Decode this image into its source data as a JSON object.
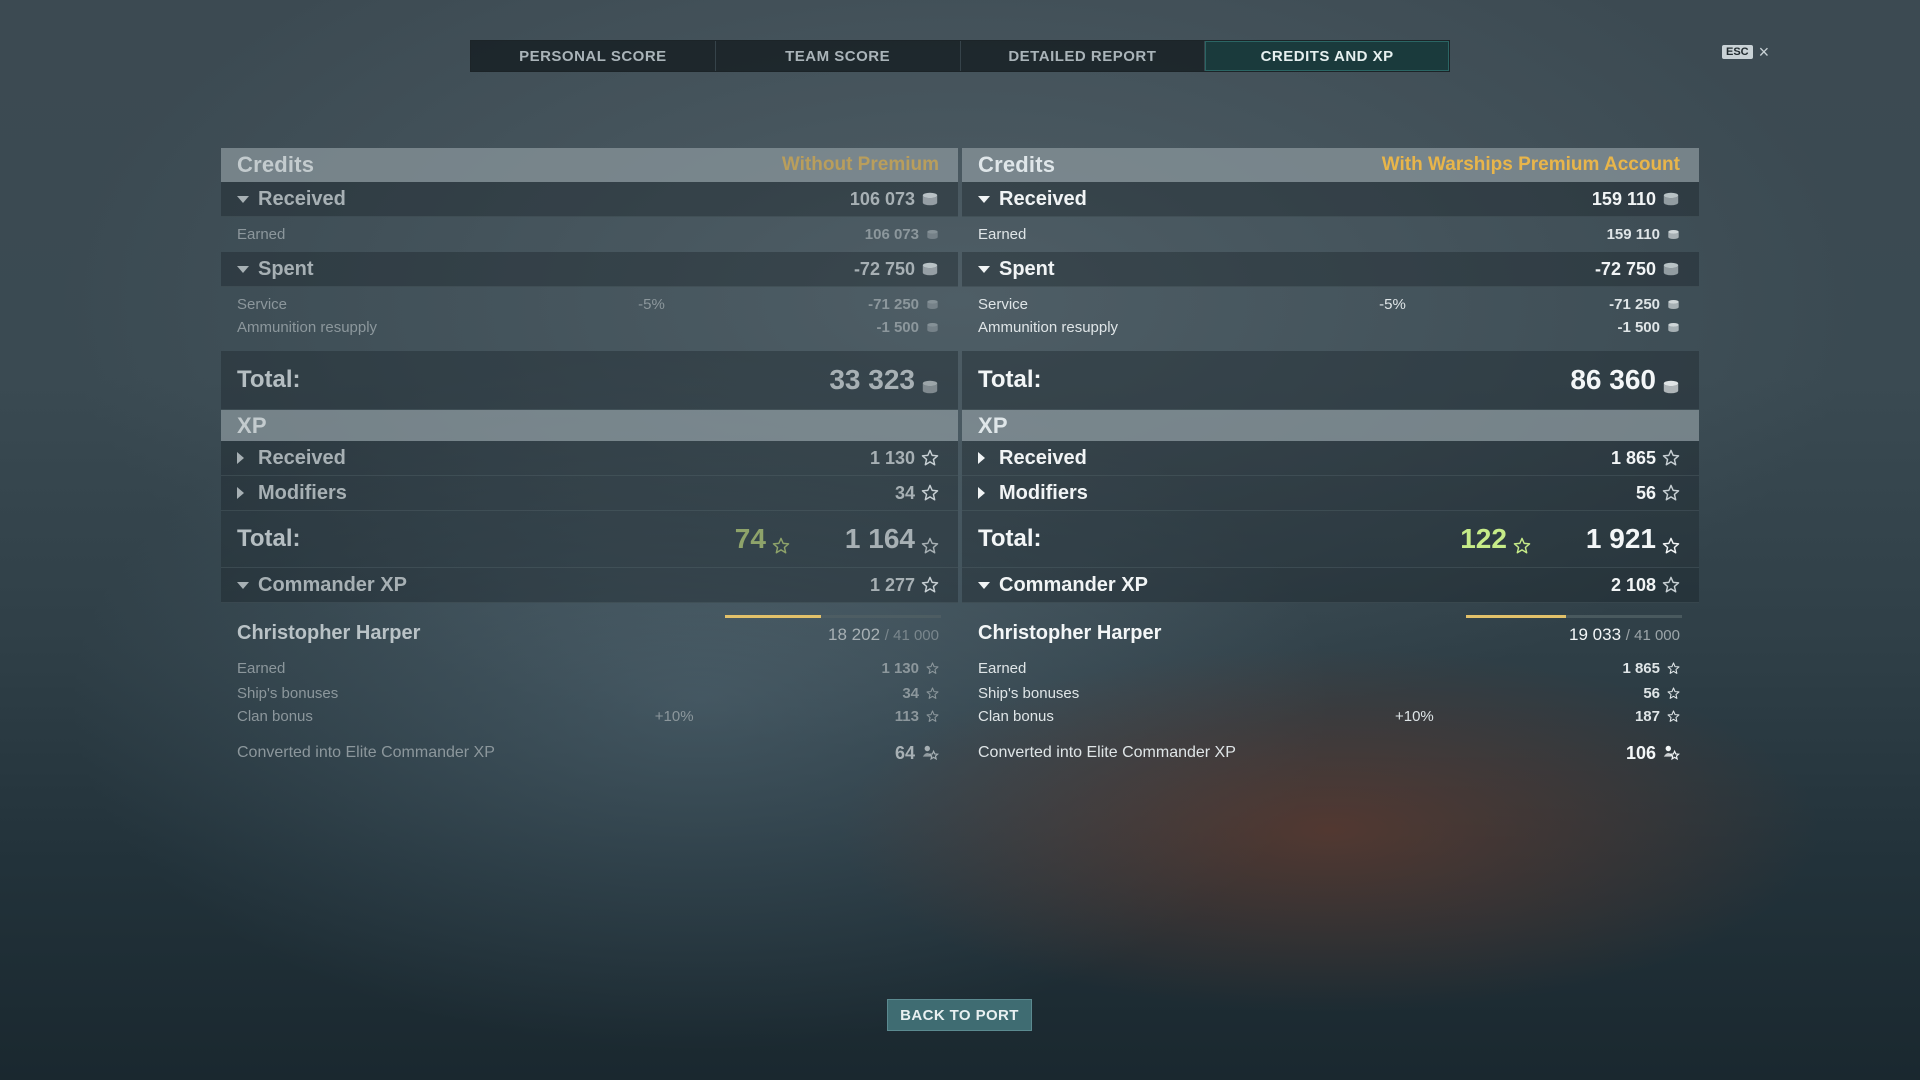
{
  "tabs": [
    "PERSONAL SCORE",
    "TEAM SCORE",
    "DETAILED REPORT",
    "CREDITS AND XP"
  ],
  "active_tab": 3,
  "esc": {
    "key": "ESC",
    "close": "×"
  },
  "left": {
    "credits_title": "Credits",
    "premium_label": "Without Premium",
    "received_label": "Received",
    "received_value": "106 073",
    "earned_label": "Earned",
    "earned_value": "106 073",
    "spent_label": "Spent",
    "spent_value": "-72 750",
    "service_label": "Service",
    "service_pct": "-5%",
    "service_value": "-71 250",
    "ammo_label": "Ammunition resupply",
    "ammo_value": "-1 500",
    "total_label": "Total:",
    "credits_total": "33 323",
    "xp_title": "XP",
    "xp_received_label": "Received",
    "xp_received_value": "1 130",
    "modifiers_label": "Modifiers",
    "modifiers_value": "34",
    "xp_total_label": "Total:",
    "xp_bonus": "74",
    "xp_total": "1 164",
    "cmd_label": "Commander XP",
    "cmd_value": "1 277",
    "commander_name": "Christopher Harper",
    "cmd_progress": "18 202",
    "cmd_max": "/ 41 000",
    "cmd_progress_fraction": 0.444,
    "cmd_earned_label": "Earned",
    "cmd_earned_value": "1 130",
    "ship_bonus_label": "Ship's bonuses",
    "ship_bonus_value": "34",
    "clan_bonus_label": "Clan bonus",
    "clan_bonus_pct": "+10%",
    "clan_bonus_value": "113",
    "converted_label": "Converted into Elite Commander XP",
    "converted_value": "64"
  },
  "right": {
    "credits_title": "Credits",
    "premium_label": "With Warships Premium Account",
    "received_label": "Received",
    "received_value": "159 110",
    "earned_label": "Earned",
    "earned_value": "159 110",
    "spent_label": "Spent",
    "spent_value": "-72 750",
    "service_label": "Service",
    "service_pct": "-5%",
    "service_value": "-71 250",
    "ammo_label": "Ammunition resupply",
    "ammo_value": "-1 500",
    "total_label": "Total:",
    "credits_total": "86 360",
    "xp_title": "XP",
    "xp_received_label": "Received",
    "xp_received_value": "1 865",
    "modifiers_label": "Modifiers",
    "modifiers_value": "56",
    "xp_total_label": "Total:",
    "xp_bonus": "122",
    "xp_total": "1 921",
    "cmd_label": "Commander XP",
    "cmd_value": "2 108",
    "commander_name": "Christopher Harper",
    "cmd_progress": "19 033",
    "cmd_max": "/ 41 000",
    "cmd_progress_fraction": 0.464,
    "cmd_earned_label": "Earned",
    "cmd_earned_value": "1 865",
    "ship_bonus_label": "Ship's bonuses",
    "ship_bonus_value": "56",
    "clan_bonus_label": "Clan bonus",
    "clan_bonus_pct": "+10%",
    "clan_bonus_value": "187",
    "converted_label": "Converted into Elite Commander XP",
    "converted_value": "106"
  },
  "back_button": "BACK TO PORT",
  "icons": {
    "credits": "silver-coin-icon",
    "xp": "star-icon",
    "elite_xp": "elite-commander-xp-icon"
  },
  "colors": {
    "premium_gold": "#e8b54a",
    "bonus_green": "#c6eb88",
    "active_tab": "#1a3a3c",
    "button": "#3f6c72"
  }
}
